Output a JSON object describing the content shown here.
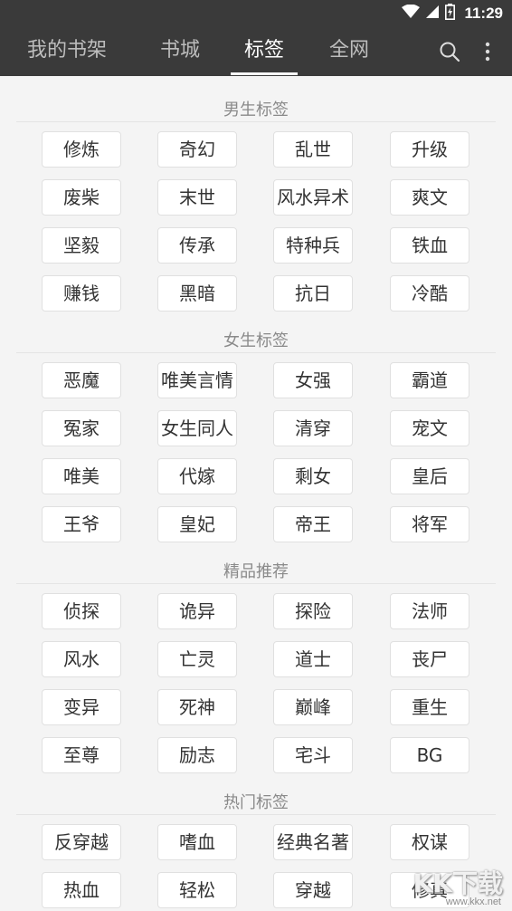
{
  "status_bar": {
    "time": "11:29",
    "icons": [
      "wifi-icon",
      "signal-icon",
      "battery-charging-icon"
    ]
  },
  "app_bar": {
    "tabs": [
      {
        "label": "我的书架",
        "active": false
      },
      {
        "label": "书城",
        "active": false
      },
      {
        "label": "标签",
        "active": true
      },
      {
        "label": "全网",
        "active": false
      }
    ],
    "icons": [
      "search-icon",
      "more-vertical-icon"
    ]
  },
  "sections": [
    {
      "title": "男生标签",
      "tags": [
        "修炼",
        "奇幻",
        "乱世",
        "升级",
        "废柴",
        "末世",
        "风水异术",
        "爽文",
        "坚毅",
        "传承",
        "特种兵",
        "铁血",
        "赚钱",
        "黑暗",
        "抗日",
        "冷酷"
      ]
    },
    {
      "title": "女生标签",
      "tags": [
        "恶魔",
        "唯美言情",
        "女强",
        "霸道",
        "冤家",
        "女生同人",
        "清穿",
        "宠文",
        "唯美",
        "代嫁",
        "剩女",
        "皇后",
        "王爷",
        "皇妃",
        "帝王",
        "将军"
      ]
    },
    {
      "title": "精品推荐",
      "tags": [
        "侦探",
        "诡异",
        "探险",
        "法师",
        "风水",
        "亡灵",
        "道士",
        "丧尸",
        "变异",
        "死神",
        "巅峰",
        "重生",
        "至尊",
        "励志",
        "宅斗",
        "BG"
      ]
    },
    {
      "title": "热门标签",
      "tags": [
        "反穿越",
        "嗜血",
        "经典名著",
        "权谋",
        "热血",
        "轻松",
        "穿越",
        "修真"
      ]
    }
  ],
  "watermark": {
    "text": "KK下载",
    "url": "www.kkx.net"
  },
  "colors": {
    "app_bar": "#3a3a3a",
    "background": "#f4f4f4",
    "tag_bg": "#ffffff",
    "tag_border": "#e0e0e0",
    "section_title": "#8a8a8a"
  }
}
